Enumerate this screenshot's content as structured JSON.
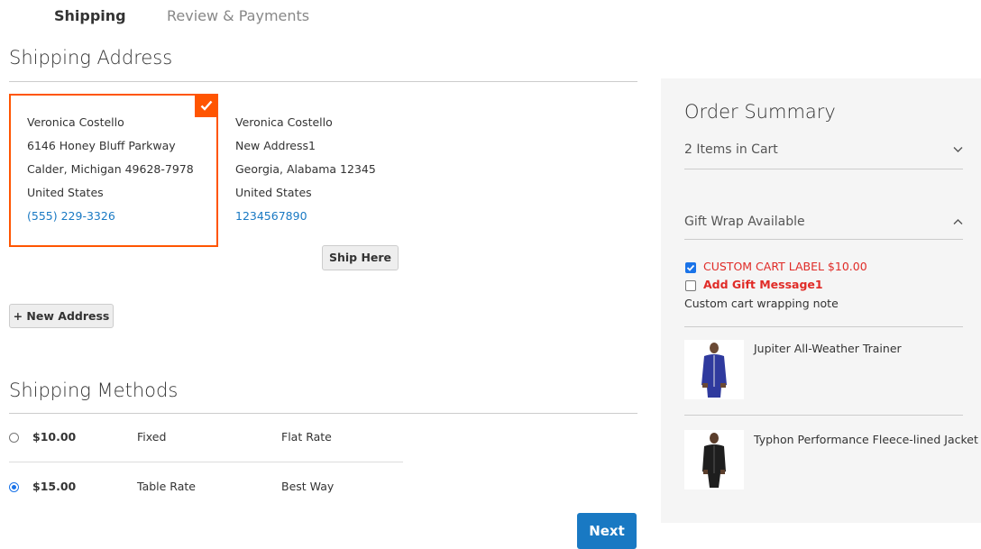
{
  "progress": {
    "step1": "Shipping",
    "step2": "Review & Payments"
  },
  "shipping_address": {
    "title": "Shipping Address",
    "selected": {
      "name": "Veronica Costello",
      "street": "6146 Honey Bluff Parkway",
      "city_line": "Calder, Michigan 49628-7978",
      "country": "United States",
      "phone": "(555) 229-3326"
    },
    "other": {
      "name": "Veronica Costello",
      "street": "New Address1",
      "city_line": "Georgia, Alabama 12345",
      "country": "United States",
      "phone": "1234567890"
    },
    "ship_here_label": "Ship Here",
    "new_address_label": "+ New Address"
  },
  "shipping_methods": {
    "title": "Shipping Methods",
    "rows": [
      {
        "price": "$10.00",
        "method": "Fixed",
        "carrier": "Flat Rate",
        "selected": false
      },
      {
        "price": "$15.00",
        "method": "Table Rate",
        "carrier": "Best Way",
        "selected": true
      }
    ],
    "next_label": "Next"
  },
  "order_summary": {
    "title": "Order Summary",
    "items_in_cart": "2 Items in Cart",
    "gift_wrap_title": "Gift Wrap Available",
    "gift_options": [
      {
        "label": "CUSTOM CART LABEL $10.00",
        "checked": true
      },
      {
        "label": "Add Gift Message1",
        "checked": false
      }
    ],
    "wrap_note": "Custom cart wrapping note",
    "items": [
      {
        "name": "Jupiter All-Weather Trainer"
      },
      {
        "name": "Typhon Performance Fleece-lined Jacket"
      }
    ]
  },
  "colors": {
    "accent": "#ff5501",
    "link": "#1979c3",
    "primary_button": "#1979c3",
    "alert_text": "#e02b27"
  }
}
